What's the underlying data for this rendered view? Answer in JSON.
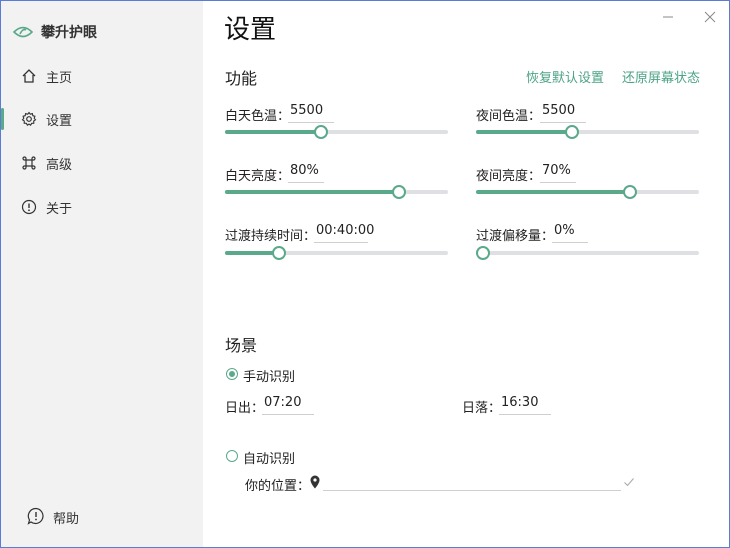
{
  "app": {
    "title": "攀升护眼"
  },
  "sidebar": {
    "items": [
      {
        "label": "主页",
        "icon": "home-icon"
      },
      {
        "label": "设置",
        "icon": "gear-icon",
        "active": true
      },
      {
        "label": "高级",
        "icon": "command-icon"
      },
      {
        "label": "关于",
        "icon": "info-icon"
      }
    ],
    "help": {
      "label": "帮助",
      "icon": "help-chat-icon"
    }
  },
  "page": {
    "title": "设置"
  },
  "function": {
    "title": "功能",
    "restore_default_label": "恢复默认设置",
    "restore_screen_label": "还原屏幕状态",
    "day_temp": {
      "label": "白天色温：",
      "value": "5500",
      "percent": 43
    },
    "night_temp": {
      "label": "夜间色温：",
      "value": "5500",
      "percent": 43
    },
    "day_brightness": {
      "label": "白天亮度：",
      "value": "80%",
      "percent": 78
    },
    "night_brightness": {
      "label": "夜间亮度：",
      "value": "70%",
      "percent": 69
    },
    "transition_duration": {
      "label": "过渡持续时间：",
      "value": "00:40:00",
      "percent": 24
    },
    "transition_offset": {
      "label": "过渡偏移量：",
      "value": "0%",
      "percent": 3
    }
  },
  "scene": {
    "title": "场景",
    "manual": {
      "label": "手动识别",
      "checked": true
    },
    "sunrise": {
      "label": "日出：",
      "value": "07:20"
    },
    "sunset": {
      "label": "日落：",
      "value": "16:30"
    },
    "auto": {
      "label": "自动识别",
      "checked": false
    },
    "location": {
      "label": "你的位置：",
      "value": ""
    }
  },
  "colors": {
    "accent": "#5aa98b",
    "track": "#dfe0e4",
    "link": "#4ca386"
  }
}
